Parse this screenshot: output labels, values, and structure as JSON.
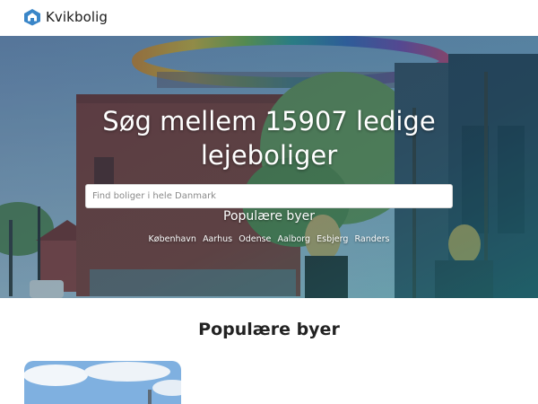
{
  "header": {
    "brand": "Kvikbolig",
    "logo_icon": "house-icon",
    "brand_color": "#3a86c8"
  },
  "hero": {
    "title_line1": "Søg mellem 15907 ledige",
    "title_line2": "lejeboliger",
    "search_placeholder": "Find boliger i hele Danmark",
    "popular_heading": "Populære byer",
    "cities": [
      "København",
      "Aarhus",
      "Odense",
      "Aalborg",
      "Esbjerg",
      "Randers"
    ]
  },
  "main": {
    "section_title": "Populære byer"
  }
}
